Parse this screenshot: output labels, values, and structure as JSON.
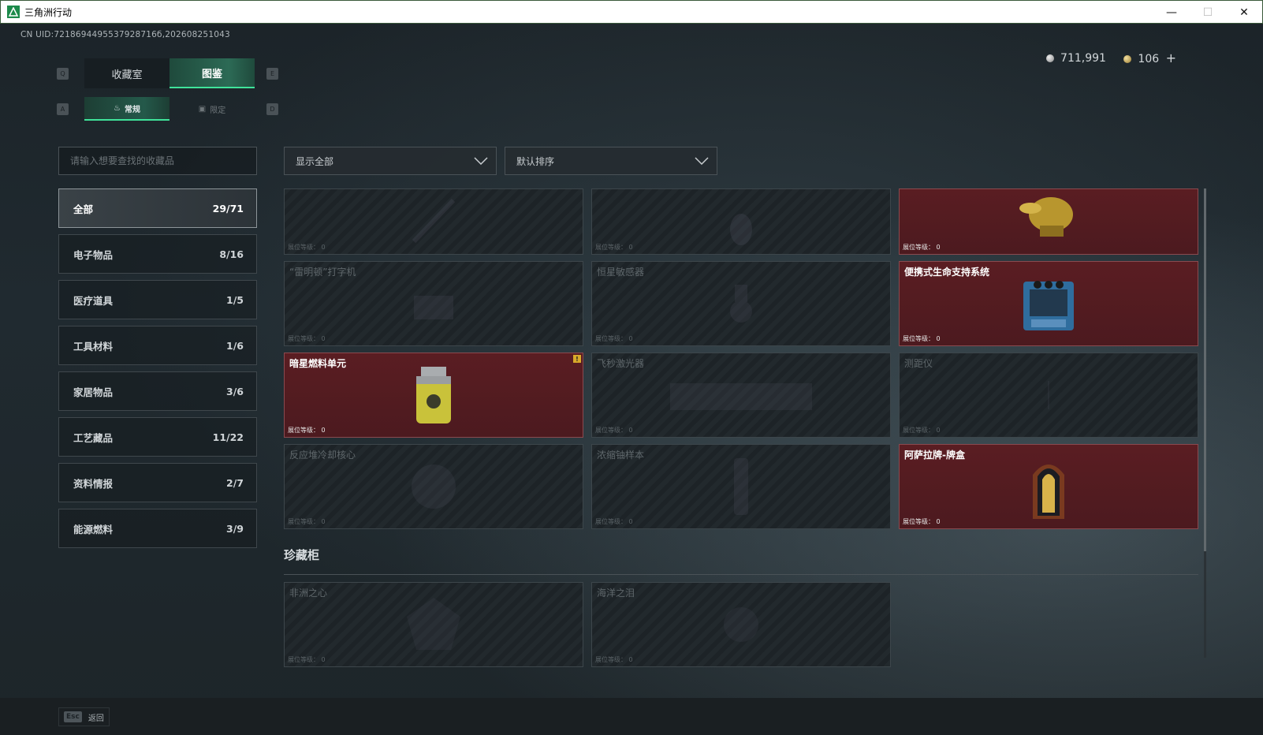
{
  "window": {
    "title": "三角洲行动",
    "app_icon": "delta-force-icon",
    "minimize_icon": "—",
    "maximize_icon": "☐",
    "close_icon": "✕"
  },
  "uid": "CN UID:7218694495537928716б,202608251043",
  "main_tabs": [
    {
      "label": "收藏室",
      "active": false
    },
    {
      "label": "图鉴",
      "active": true
    }
  ],
  "main_tab_keys": {
    "left": "Q",
    "right": "E"
  },
  "sub_tabs": [
    {
      "label": "常规",
      "icon": "flame-icon",
      "active": true
    },
    {
      "label": "限定",
      "icon": "picture-icon",
      "active": false
    }
  ],
  "sub_tab_keys": {
    "left": "A",
    "right": "D"
  },
  "currency": {
    "silver": "711,991",
    "gold": "106",
    "plus": "+"
  },
  "search": {
    "placeholder": "请输入想要查找的收藏品",
    "value": ""
  },
  "categories": [
    {
      "label": "全部",
      "count": "29/71",
      "active": true
    },
    {
      "label": "电子物品",
      "count": "8/16"
    },
    {
      "label": "医疗道具",
      "count": "1/5"
    },
    {
      "label": "工具材料",
      "count": "1/6"
    },
    {
      "label": "家居物品",
      "count": "3/6"
    },
    {
      "label": "工艺藏品",
      "count": "11/22"
    },
    {
      "label": "资料情报",
      "count": "2/7"
    },
    {
      "label": "能源燃料",
      "count": "3/9"
    }
  ],
  "filters": {
    "display": "显示全部",
    "sort": "默认排序"
  },
  "level_label": "展位等级：",
  "items": [
    {
      "name": "",
      "level": "0",
      "owned": false
    },
    {
      "name": "",
      "level": "0",
      "owned": false
    },
    {
      "name": "",
      "level": "0",
      "owned": true
    },
    {
      "name": "“雷明顿”打字机",
      "level": "0",
      "owned": false
    },
    {
      "name": "恒星敏感器",
      "level": "0",
      "owned": false
    },
    {
      "name": "便携式生命支持系统",
      "level": "0",
      "owned": true
    },
    {
      "name": "暗星燃料单元",
      "level": "0",
      "owned": true,
      "warn": "!"
    },
    {
      "name": "飞秒激光器",
      "level": "0",
      "owned": false
    },
    {
      "name": "测距仪",
      "level": "0",
      "owned": false
    },
    {
      "name": "反应堆冷却核心",
      "level": "0",
      "owned": false
    },
    {
      "name": "浓缩铀样本",
      "level": "0",
      "owned": false
    },
    {
      "name": "阿萨拉牌-牌盒",
      "level": "0",
      "owned": true
    }
  ],
  "treasure_section": {
    "title": "珍藏柜",
    "items": [
      {
        "name": "非洲之心",
        "level": "0",
        "owned": false
      },
      {
        "name": "海洋之泪",
        "level": "0",
        "owned": false
      }
    ]
  },
  "footer": {
    "key": "Esc",
    "label": "返回"
  },
  "colors": {
    "accent_green": "#3fe39a",
    "owned_card": "#5a1d22",
    "background": "#1c2429"
  }
}
